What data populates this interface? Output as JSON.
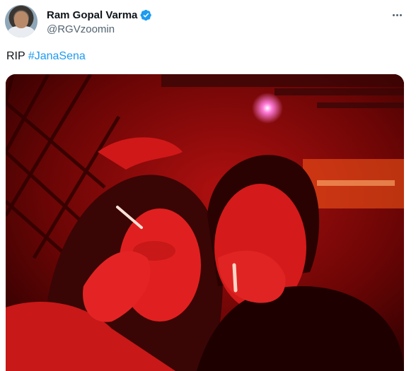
{
  "author": {
    "display_name": "Ram Gopal Varma",
    "handle": "@RGVzoomin",
    "verified": true,
    "verified_color": "#1d9bf0"
  },
  "tweet": {
    "text_prefix": "RIP ",
    "hashtag": "#JanaSena",
    "hashtag_color": "#1d9bf0"
  },
  "icons": {
    "more": "more-horizontal-icon",
    "verified": "verified-badge-icon"
  },
  "media": {
    "description_tone": "red-lit"
  }
}
